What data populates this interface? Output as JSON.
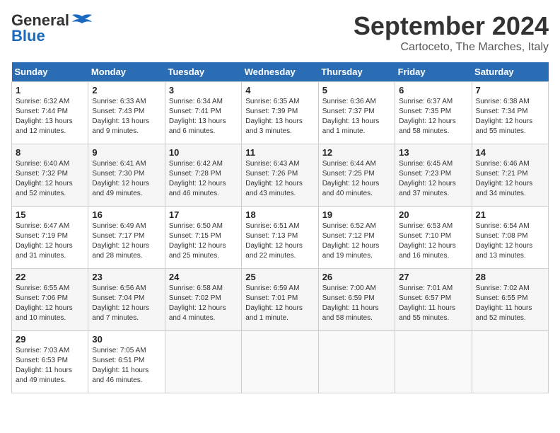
{
  "header": {
    "logo_general": "General",
    "logo_blue": "Blue",
    "month": "September 2024",
    "location": "Cartoceto, The Marches, Italy"
  },
  "days_of_week": [
    "Sunday",
    "Monday",
    "Tuesday",
    "Wednesday",
    "Thursday",
    "Friday",
    "Saturday"
  ],
  "weeks": [
    [
      {
        "day": "1",
        "sunrise": "Sunrise: 6:32 AM",
        "sunset": "Sunset: 7:44 PM",
        "daylight": "Daylight: 13 hours and 12 minutes."
      },
      {
        "day": "2",
        "sunrise": "Sunrise: 6:33 AM",
        "sunset": "Sunset: 7:43 PM",
        "daylight": "Daylight: 13 hours and 9 minutes."
      },
      {
        "day": "3",
        "sunrise": "Sunrise: 6:34 AM",
        "sunset": "Sunset: 7:41 PM",
        "daylight": "Daylight: 13 hours and 6 minutes."
      },
      {
        "day": "4",
        "sunrise": "Sunrise: 6:35 AM",
        "sunset": "Sunset: 7:39 PM",
        "daylight": "Daylight: 13 hours and 3 minutes."
      },
      {
        "day": "5",
        "sunrise": "Sunrise: 6:36 AM",
        "sunset": "Sunset: 7:37 PM",
        "daylight": "Daylight: 13 hours and 1 minute."
      },
      {
        "day": "6",
        "sunrise": "Sunrise: 6:37 AM",
        "sunset": "Sunset: 7:35 PM",
        "daylight": "Daylight: 12 hours and 58 minutes."
      },
      {
        "day": "7",
        "sunrise": "Sunrise: 6:38 AM",
        "sunset": "Sunset: 7:34 PM",
        "daylight": "Daylight: 12 hours and 55 minutes."
      }
    ],
    [
      {
        "day": "8",
        "sunrise": "Sunrise: 6:40 AM",
        "sunset": "Sunset: 7:32 PM",
        "daylight": "Daylight: 12 hours and 52 minutes."
      },
      {
        "day": "9",
        "sunrise": "Sunrise: 6:41 AM",
        "sunset": "Sunset: 7:30 PM",
        "daylight": "Daylight: 12 hours and 49 minutes."
      },
      {
        "day": "10",
        "sunrise": "Sunrise: 6:42 AM",
        "sunset": "Sunset: 7:28 PM",
        "daylight": "Daylight: 12 hours and 46 minutes."
      },
      {
        "day": "11",
        "sunrise": "Sunrise: 6:43 AM",
        "sunset": "Sunset: 7:26 PM",
        "daylight": "Daylight: 12 hours and 43 minutes."
      },
      {
        "day": "12",
        "sunrise": "Sunrise: 6:44 AM",
        "sunset": "Sunset: 7:25 PM",
        "daylight": "Daylight: 12 hours and 40 minutes."
      },
      {
        "day": "13",
        "sunrise": "Sunrise: 6:45 AM",
        "sunset": "Sunset: 7:23 PM",
        "daylight": "Daylight: 12 hours and 37 minutes."
      },
      {
        "day": "14",
        "sunrise": "Sunrise: 6:46 AM",
        "sunset": "Sunset: 7:21 PM",
        "daylight": "Daylight: 12 hours and 34 minutes."
      }
    ],
    [
      {
        "day": "15",
        "sunrise": "Sunrise: 6:47 AM",
        "sunset": "Sunset: 7:19 PM",
        "daylight": "Daylight: 12 hours and 31 minutes."
      },
      {
        "day": "16",
        "sunrise": "Sunrise: 6:49 AM",
        "sunset": "Sunset: 7:17 PM",
        "daylight": "Daylight: 12 hours and 28 minutes."
      },
      {
        "day": "17",
        "sunrise": "Sunrise: 6:50 AM",
        "sunset": "Sunset: 7:15 PM",
        "daylight": "Daylight: 12 hours and 25 minutes."
      },
      {
        "day": "18",
        "sunrise": "Sunrise: 6:51 AM",
        "sunset": "Sunset: 7:13 PM",
        "daylight": "Daylight: 12 hours and 22 minutes."
      },
      {
        "day": "19",
        "sunrise": "Sunrise: 6:52 AM",
        "sunset": "Sunset: 7:12 PM",
        "daylight": "Daylight: 12 hours and 19 minutes."
      },
      {
        "day": "20",
        "sunrise": "Sunrise: 6:53 AM",
        "sunset": "Sunset: 7:10 PM",
        "daylight": "Daylight: 12 hours and 16 minutes."
      },
      {
        "day": "21",
        "sunrise": "Sunrise: 6:54 AM",
        "sunset": "Sunset: 7:08 PM",
        "daylight": "Daylight: 12 hours and 13 minutes."
      }
    ],
    [
      {
        "day": "22",
        "sunrise": "Sunrise: 6:55 AM",
        "sunset": "Sunset: 7:06 PM",
        "daylight": "Daylight: 12 hours and 10 minutes."
      },
      {
        "day": "23",
        "sunrise": "Sunrise: 6:56 AM",
        "sunset": "Sunset: 7:04 PM",
        "daylight": "Daylight: 12 hours and 7 minutes."
      },
      {
        "day": "24",
        "sunrise": "Sunrise: 6:58 AM",
        "sunset": "Sunset: 7:02 PM",
        "daylight": "Daylight: 12 hours and 4 minutes."
      },
      {
        "day": "25",
        "sunrise": "Sunrise: 6:59 AM",
        "sunset": "Sunset: 7:01 PM",
        "daylight": "Daylight: 12 hours and 1 minute."
      },
      {
        "day": "26",
        "sunrise": "Sunrise: 7:00 AM",
        "sunset": "Sunset: 6:59 PM",
        "daylight": "Daylight: 11 hours and 58 minutes."
      },
      {
        "day": "27",
        "sunrise": "Sunrise: 7:01 AM",
        "sunset": "Sunset: 6:57 PM",
        "daylight": "Daylight: 11 hours and 55 minutes."
      },
      {
        "day": "28",
        "sunrise": "Sunrise: 7:02 AM",
        "sunset": "Sunset: 6:55 PM",
        "daylight": "Daylight: 11 hours and 52 minutes."
      }
    ],
    [
      {
        "day": "29",
        "sunrise": "Sunrise: 7:03 AM",
        "sunset": "Sunset: 6:53 PM",
        "daylight": "Daylight: 11 hours and 49 minutes."
      },
      {
        "day": "30",
        "sunrise": "Sunrise: 7:05 AM",
        "sunset": "Sunset: 6:51 PM",
        "daylight": "Daylight: 11 hours and 46 minutes."
      },
      null,
      null,
      null,
      null,
      null
    ]
  ]
}
